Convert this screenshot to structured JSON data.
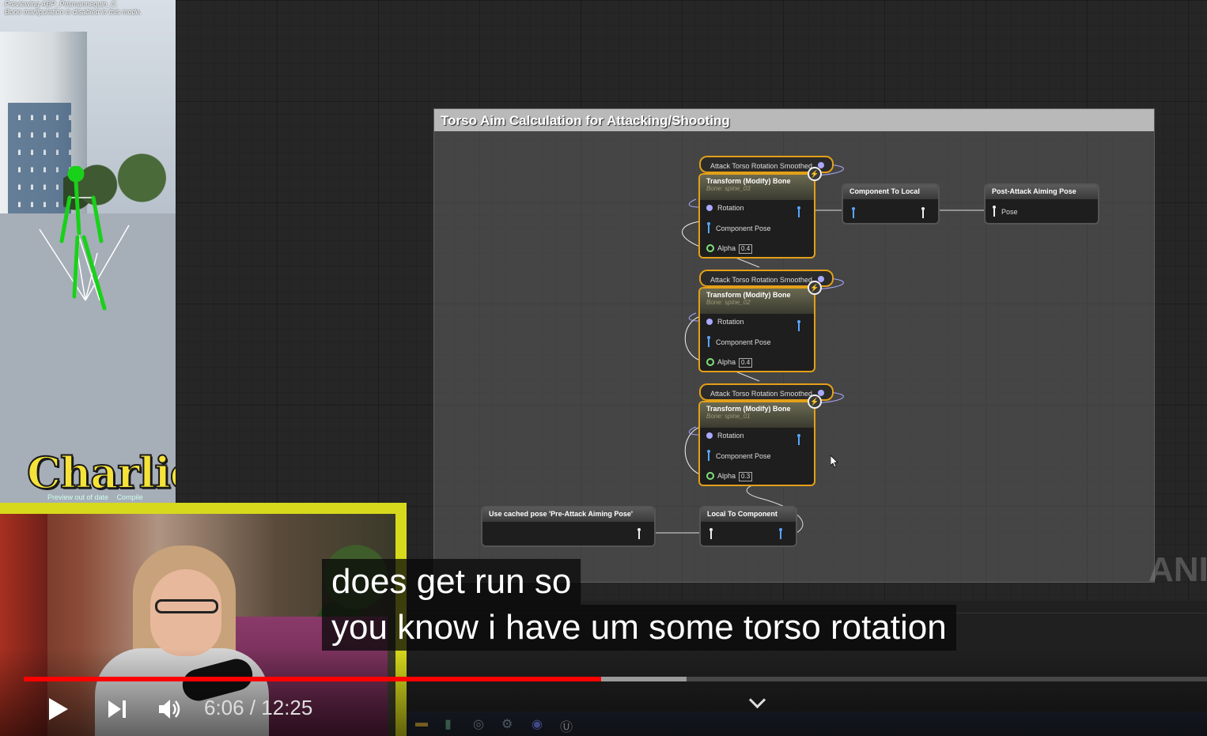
{
  "viewport": {
    "header_line1": "Previewing ABP_Prismannequin_C.",
    "header_line2": "Bone manipulation is disabled in this mode.",
    "brand": "Charlie",
    "status_preview": "Preview out of date",
    "status_compile": "Compile"
  },
  "graph": {
    "comment_title": "Torso Aim Calculation for Attacking/Shooting",
    "watermark": "ANI",
    "var_nodes": [
      {
        "label": "Attack Torso Rotation Smoothed"
      },
      {
        "label": "Attack Torso Rotation Smoothed"
      },
      {
        "label": "Attack Torso Rotation Smoothed"
      }
    ],
    "transform_nodes": [
      {
        "title": "Transform (Modify) Bone",
        "bone": "Bone: spine_03",
        "rotation": "Rotation",
        "component_pose": "Component Pose",
        "alpha": "Alpha",
        "alpha_value": "0.4"
      },
      {
        "title": "Transform (Modify) Bone",
        "bone": "Bone: spine_02",
        "rotation": "Rotation",
        "component_pose": "Component Pose",
        "alpha": "Alpha",
        "alpha_value": "0.4"
      },
      {
        "title": "Transform (Modify) Bone",
        "bone": "Bone: spine_01",
        "rotation": "Rotation",
        "component_pose": "Component Pose",
        "alpha": "Alpha",
        "alpha_value": "0.3"
      }
    ],
    "component_to_local": "Component To Local",
    "post_attack": {
      "title": "Post-Attack Aiming Pose",
      "pin": "Pose"
    },
    "cached_pose": "Use cached pose 'Pre-Attack Aiming Pose'",
    "local_to_component": "Local To Component"
  },
  "subtitles": {
    "line1": "does get run so",
    "line2": "you know i have um some torso rotation"
  },
  "player": {
    "current_time": "6:06",
    "duration": "12:25",
    "time_display": "6:06 / 12:25",
    "progress_fraction": 0.488,
    "buffered_fraction": 0.56,
    "progress_color": "#ff0000"
  },
  "taskbar": {
    "icons": [
      "folder-icon",
      "chart-icon",
      "obs-icon",
      "steam-icon",
      "discord-icon",
      "unreal-icon"
    ]
  },
  "colors": {
    "node_border": "#e3a018",
    "vector_pin": "#a9a9ff",
    "pose_pin": "#58a6ff",
    "webcam_border": "#d7d91c"
  }
}
